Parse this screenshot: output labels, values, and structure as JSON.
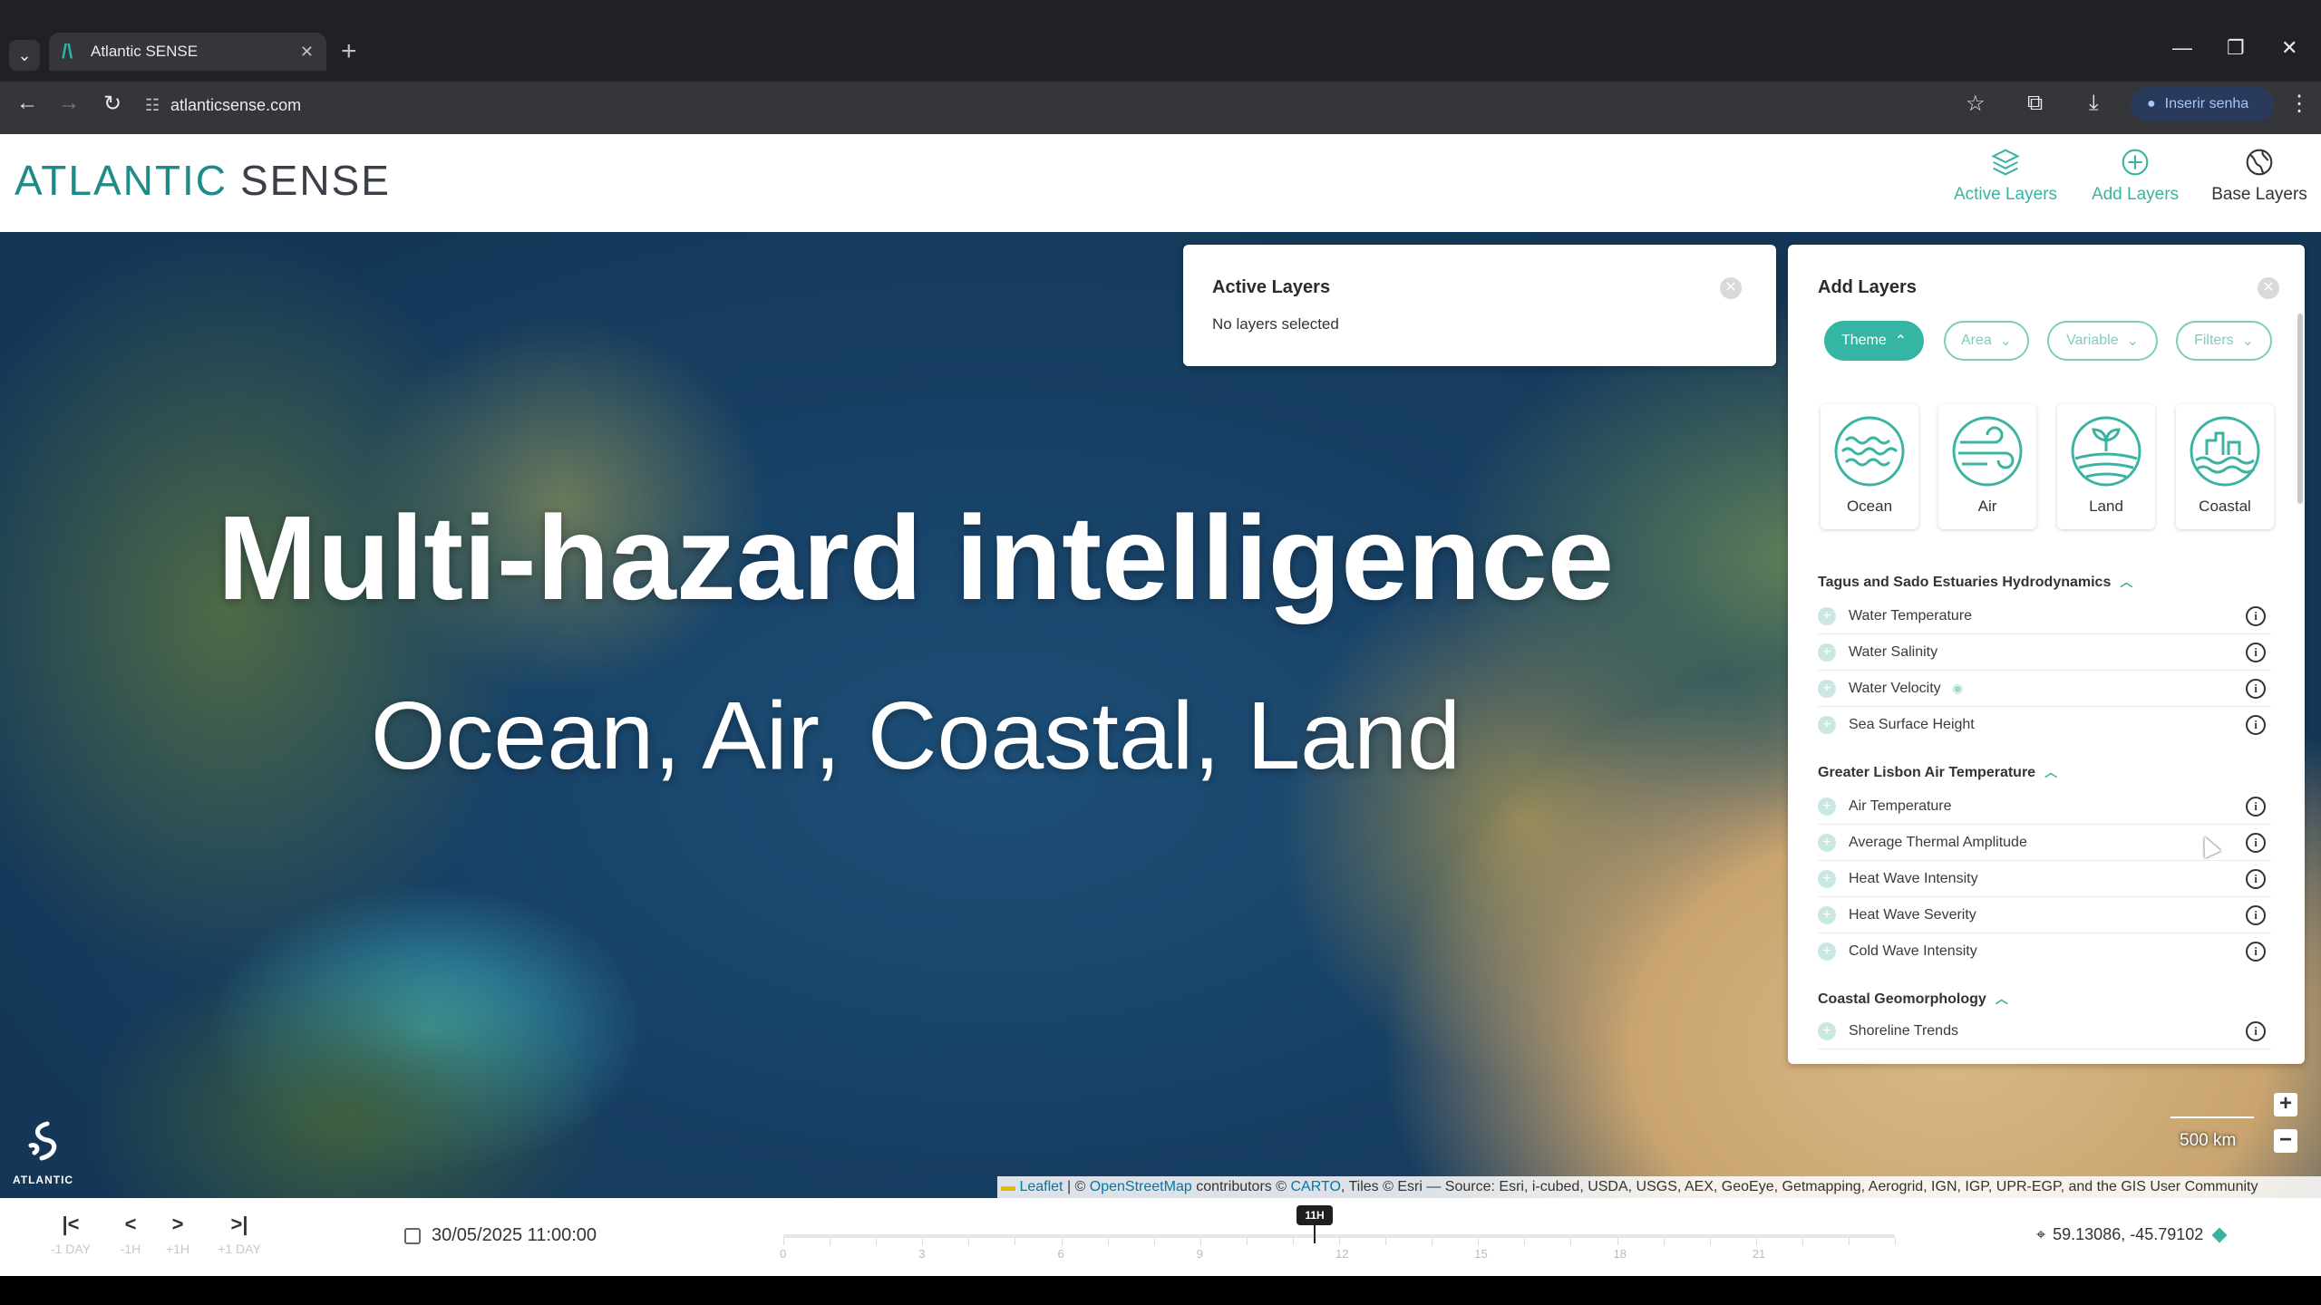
{
  "browser": {
    "tab_title": "Atlantic SENSE",
    "url": "atlanticsense.com",
    "password_button": "Inserir senha"
  },
  "app": {
    "logo_primary": "ATLANTIC",
    "logo_secondary": "SENSE",
    "nav": {
      "active_layers": "Active Layers",
      "add_layers": "Add Layers",
      "base_layers": "Base Layers"
    },
    "accent_color": "#3bb3a3"
  },
  "hero": {
    "title": "Multi-hazard intelligence",
    "subtitle": "Ocean, Air, Coastal, Land"
  },
  "active_panel": {
    "title": "Active Layers",
    "empty_text": "No layers selected"
  },
  "add_panel": {
    "title": "Add Layers",
    "filters": [
      "Theme",
      "Area",
      "Variable",
      "Filters"
    ],
    "themes": [
      "Ocean",
      "Air",
      "Land",
      "Coastal"
    ],
    "sections": [
      {
        "title": "Tagus and Sado Estuaries Hydrodynamics",
        "layers": [
          "Water Temperature",
          "Water Salinity",
          "Water Velocity",
          "Sea Surface Height"
        ]
      },
      {
        "title": "Greater Lisbon Air Temperature",
        "layers": [
          "Air Temperature",
          "Average Thermal Amplitude",
          "Heat Wave Intensity",
          "Heat Wave Severity",
          "Cold Wave Intensity"
        ]
      },
      {
        "title": "Coastal Geomorphology",
        "layers": [
          "Shoreline Trends"
        ]
      }
    ]
  },
  "map": {
    "scale_label": "500 km",
    "attribution": {
      "leaflet": "Leaflet",
      "osm": "OpenStreetMap",
      "contributors": "contributors ©",
      "carto": "CARTO",
      "rest": ", Tiles © Esri — Source: Esri, i-cubed, USDA, USGS, AEX, GeoEye, Getmapping, Aerogrid, IGN, IGP, UPR-EGP, and the GIS User Community"
    },
    "corner_logo_text": "ATLANTIC"
  },
  "timeline": {
    "controls": [
      {
        "symbol": "|<",
        "label": "-1 DAY"
      },
      {
        "symbol": "<",
        "label": "-1H"
      },
      {
        "symbol": ">",
        "label": "+1H"
      },
      {
        "symbol": ">|",
        "label": "+1 DAY"
      }
    ],
    "datetime": "30/05/2025 11:00:00",
    "current_hour_label": "11H",
    "tick_labels": [
      "0",
      "3",
      "6",
      "9",
      "12",
      "15",
      "18",
      "21"
    ],
    "coordinates": "59.13086, -45.79102"
  }
}
